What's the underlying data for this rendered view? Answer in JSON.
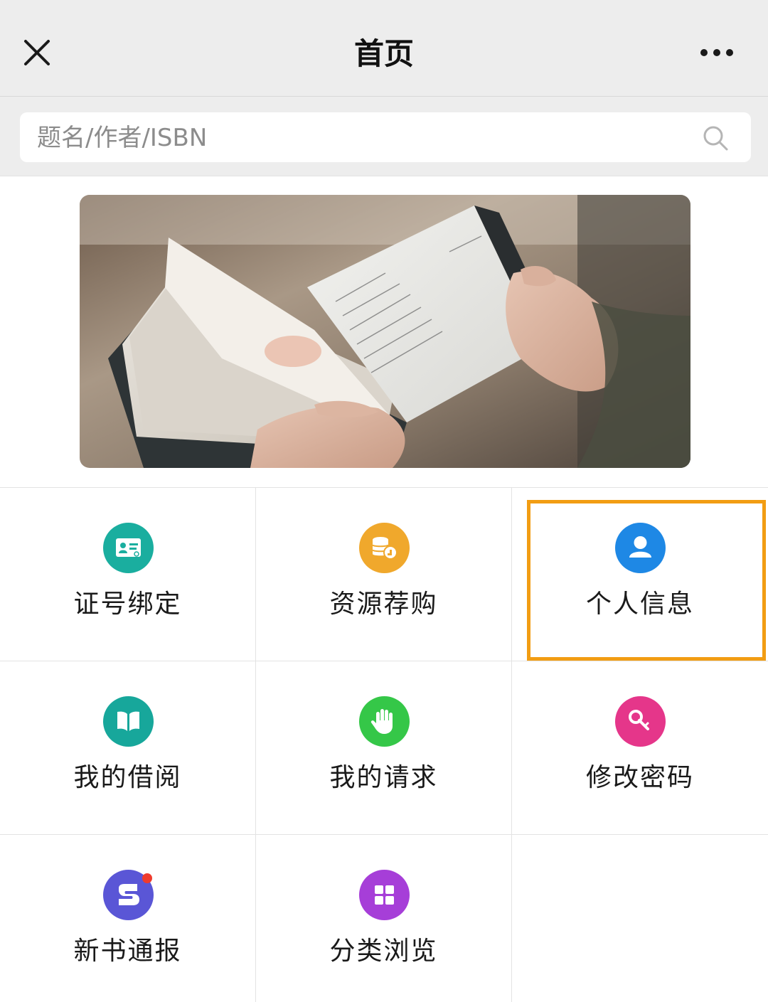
{
  "titlebar": {
    "title": "首页",
    "close_icon": "close-icon",
    "more_icon": "more-icon"
  },
  "search": {
    "placeholder": "题名/作者/ISBN",
    "icon": "search-icon"
  },
  "banner": {
    "image": "photo of hands holding an open book"
  },
  "grid": {
    "items": [
      {
        "label": "证号绑定",
        "icon": "id-card-icon",
        "color": "#1aae9f"
      },
      {
        "label": "资源荐购",
        "icon": "database-like-icon",
        "color": "#f0a82c"
      },
      {
        "label": "个人信息",
        "icon": "user-icon",
        "color": "#1e88e5",
        "highlighted": true
      },
      {
        "label": "我的借阅",
        "icon": "book-icon",
        "color": "#17a79b"
      },
      {
        "label": "我的请求",
        "icon": "hand-icon",
        "color": "#35c748"
      },
      {
        "label": "修改密码",
        "icon": "key-icon",
        "color": "#e5368a"
      },
      {
        "label": "新书通报",
        "icon": "new-book-icon",
        "color": "#5a56d6",
        "badge": true
      },
      {
        "label": "分类浏览",
        "icon": "category-grid-icon",
        "color": "#a63ed8"
      }
    ]
  },
  "colors": {
    "highlight": "#f29d13",
    "badge": "#ef3b2d"
  }
}
